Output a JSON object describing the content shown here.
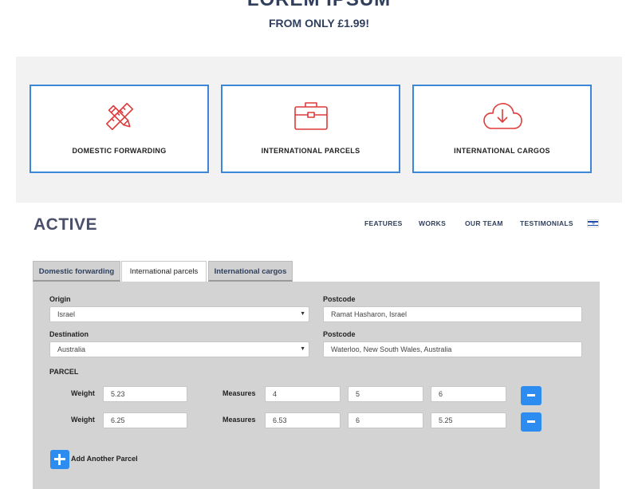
{
  "hero": {
    "title": "LOREM IPSUM",
    "subtitle": "FROM ONLY £1.99!"
  },
  "services": [
    {
      "label": "DOMESTIC FORWARDING",
      "icon": "pencil-ruler-icon"
    },
    {
      "label": "INTERNATIONAL PARCELS",
      "icon": "briefcase-icon"
    },
    {
      "label": "INTERNATIONAL CARGOS",
      "icon": "cloud-download-icon"
    }
  ],
  "header": {
    "logo": "ACTIVE",
    "nav": [
      "FEATURES",
      "WORKS",
      "OUR TEAM",
      "TESTIMONIALS"
    ],
    "language_flag": "israel-flag-icon"
  },
  "tabs": [
    {
      "label": "Domestic forwarding",
      "active": false
    },
    {
      "label": "International parcels",
      "active": true
    },
    {
      "label": "International cargos",
      "active": false
    }
  ],
  "form": {
    "origin_label": "Origin",
    "origin_value": "Israel",
    "origin_postcode_label": "Postcode",
    "origin_postcode_value": "Ramat Hasharon, Israel",
    "destination_label": "Destination",
    "destination_value": "Australia",
    "destination_postcode_label": "Postcode",
    "destination_postcode_value": "Waterloo, New South Wales, Australia",
    "parcel_heading": "PARCEL",
    "weight_label": "Weight",
    "measures_label": "Measures",
    "parcels": [
      {
        "weight": "5.23",
        "measures": [
          "4",
          "5",
          "6"
        ]
      },
      {
        "weight": "6.25",
        "measures": [
          "6.53",
          "6",
          "5.25"
        ]
      }
    ],
    "add_parcel_label": "Add Another Parcel"
  },
  "colors": {
    "accent": "#2d8cf0",
    "card_border": "#3b88d8",
    "icon": "#e03a3a",
    "heading": "#2f3f5c"
  }
}
